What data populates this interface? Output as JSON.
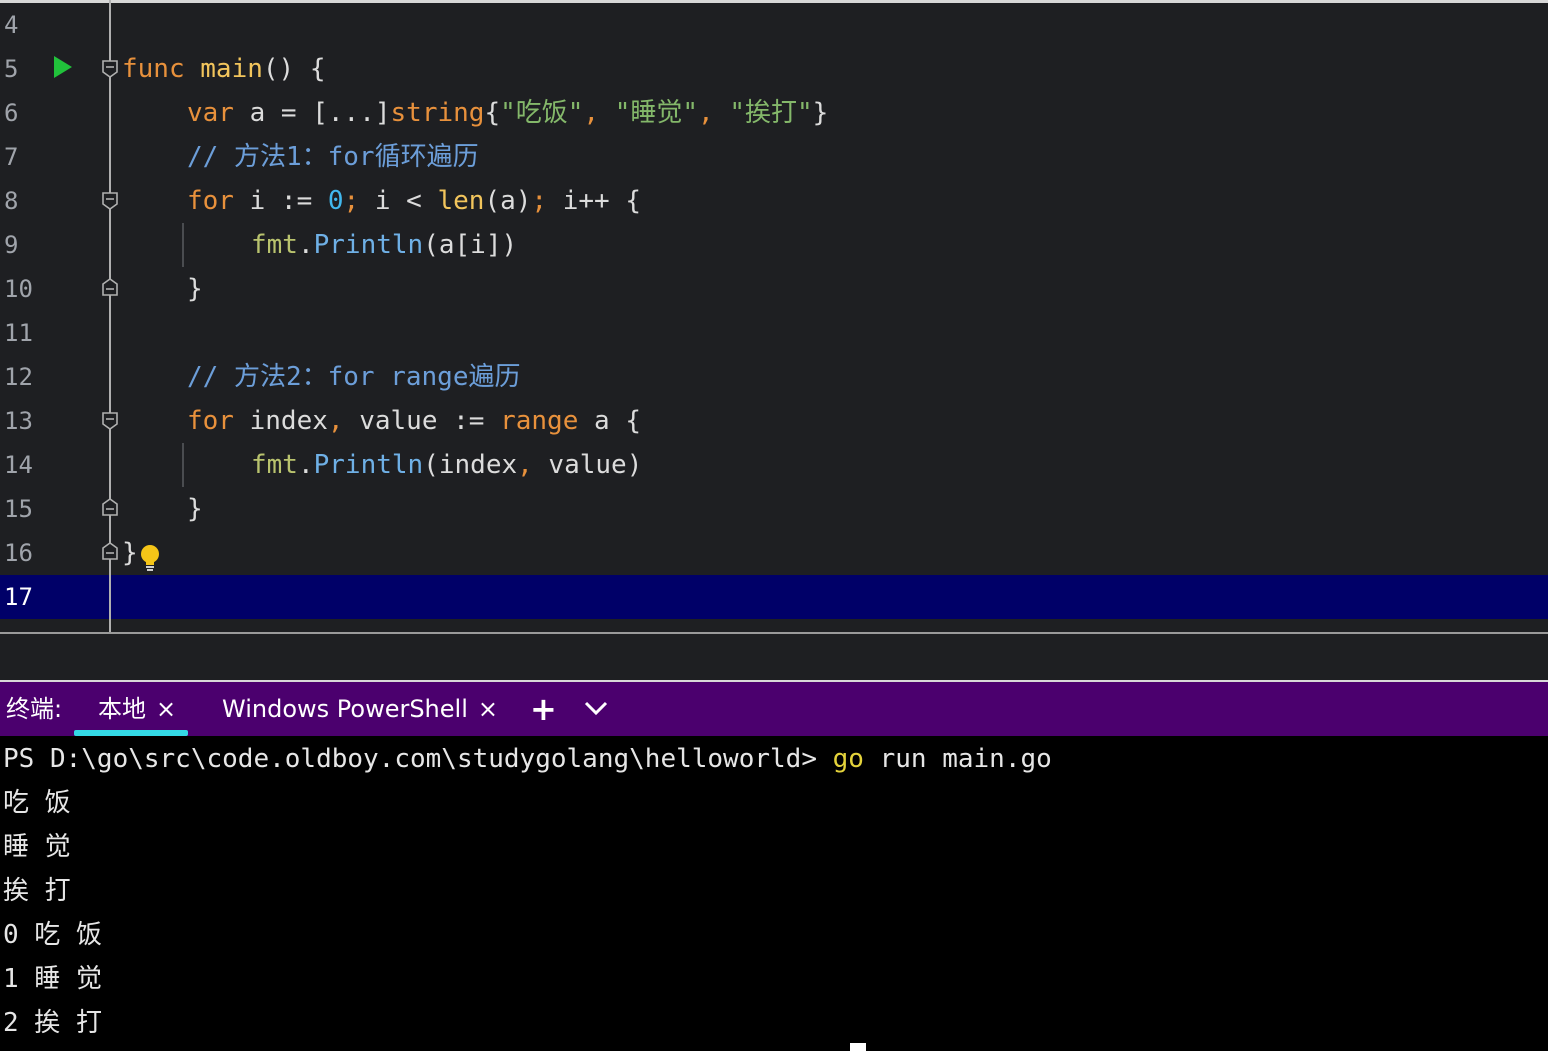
{
  "editor": {
    "line_numbers": [
      "4",
      "5",
      "6",
      "7",
      "8",
      "9",
      "10",
      "11",
      "12",
      "13",
      "14",
      "15",
      "16",
      "17"
    ],
    "current_line": "17",
    "code": {
      "l5": {
        "kw": "func",
        "fn": "main",
        "rest": "() {"
      },
      "l6": {
        "kw": "var",
        "a": " a = [...]",
        "type": "string",
        "brace": "{",
        "s1": "\"吃饭\"",
        "c1": ", ",
        "s2": "\"睡觉\"",
        "c2": ", ",
        "s3": "\"挨打\"",
        "end": "}"
      },
      "l7": {
        "comment": "// 方法1：for循环遍历"
      },
      "l8": {
        "kw": "for",
        "p1": " i := ",
        "num": "0",
        "semi1": ";",
        "p2": " i < ",
        "len": "len",
        "p3": "(a)",
        "semi2": ";",
        "p4": " i++ {"
      },
      "l9": {
        "pkg": "fmt",
        "dot": ".",
        "method": "Println",
        "args": "(a[i])"
      },
      "l10": {
        "text": "}"
      },
      "l12": {
        "comment": "// 方法2：for range遍历"
      },
      "l13": {
        "kw": "for",
        "p1": " index",
        "comma": ",",
        "p2": " value := ",
        "range": "range",
        "p3": " a {"
      },
      "l14": {
        "pkg": "fmt",
        "dot": ".",
        "method": "Println",
        "p1": "(index",
        "comma": ",",
        "p2": " value)"
      },
      "l15": {
        "text": "}"
      },
      "l16": {
        "text": "}"
      }
    }
  },
  "terminal_tabs": {
    "title": "终端:",
    "tabs": [
      {
        "label": "本地",
        "close": "×",
        "active": true
      },
      {
        "label": "Windows PowerShell",
        "close": "×",
        "active": false
      }
    ],
    "add_label": "+"
  },
  "terminal": {
    "prompt": "PS D:\\go\\src\\code.oldboy.com\\studygolang\\helloworld> ",
    "command_go": "go",
    "command_rest": " run main.go",
    "output": [
      "吃 饭",
      "睡 觉",
      "挨 打",
      "0 吃 饭",
      "1 睡 觉",
      "2 挨 打"
    ]
  },
  "colors": {
    "keyword": "#e8913c",
    "function": "#f2c55c",
    "string": "#84b86a",
    "number": "#41b8ee",
    "comment": "#6c9ed9",
    "tabbar": "#4b006e",
    "tab_indicator": "#34d9e6",
    "current_line": "#000068"
  }
}
